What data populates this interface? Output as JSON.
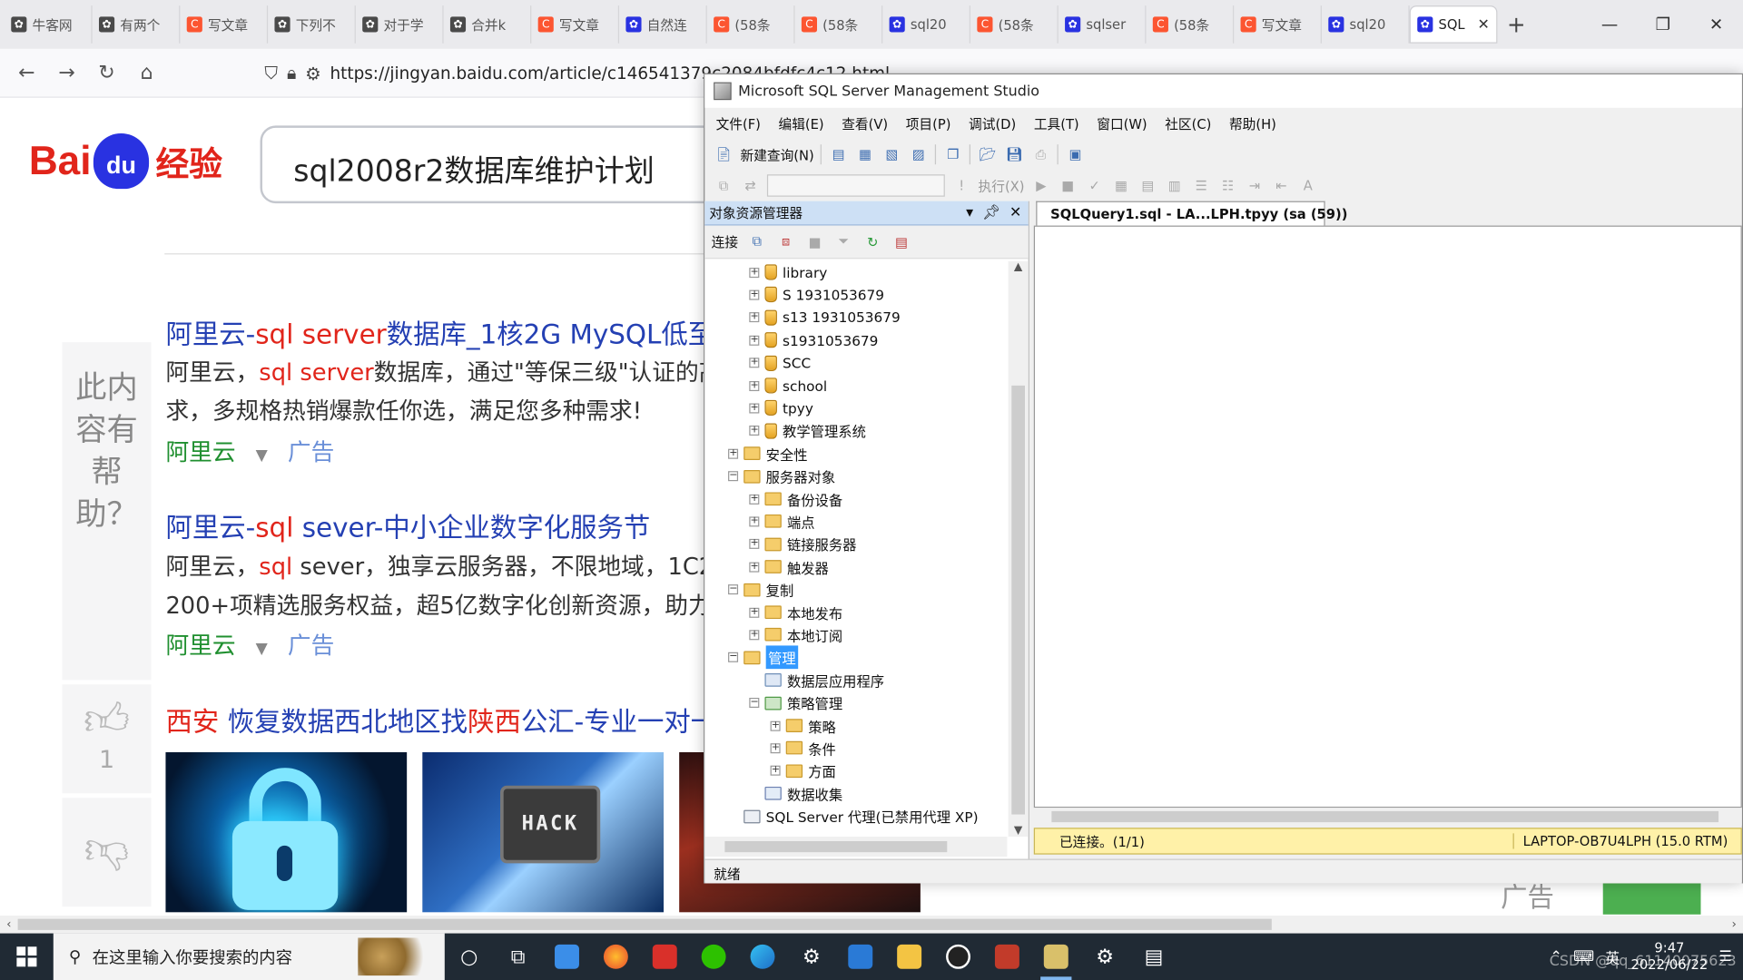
{
  "browser": {
    "tabs": [
      {
        "label": "牛客网",
        "icon": "paw-icon",
        "color": "#4a4a4a"
      },
      {
        "label": "有两个",
        "icon": "paw-icon",
        "color": "#4a4a4a"
      },
      {
        "label": "写文章",
        "icon": "csdn-c-icon",
        "color": "#fc5531"
      },
      {
        "label": "下列不",
        "icon": "paw-icon",
        "color": "#4a4a4a"
      },
      {
        "label": "对于学",
        "icon": "paw-icon",
        "color": "#4a4a4a"
      },
      {
        "label": "合并k",
        "icon": "paw-icon",
        "color": "#4a4a4a"
      },
      {
        "label": "写文章",
        "icon": "csdn-c-icon",
        "color": "#fc5531"
      },
      {
        "label": "自然连",
        "icon": "baidu-paw-icon",
        "color": "#2932e1"
      },
      {
        "label": "(58条",
        "icon": "csdn-c-icon",
        "color": "#fc5531"
      },
      {
        "label": "(58条",
        "icon": "csdn-c-icon",
        "color": "#fc5531"
      },
      {
        "label": "sql20",
        "icon": "baidu-paw-icon",
        "color": "#2932e1"
      },
      {
        "label": "(58条",
        "icon": "csdn-c-icon",
        "color": "#fc5531"
      },
      {
        "label": "sqlser",
        "icon": "baidu-paw-icon",
        "color": "#2932e1"
      },
      {
        "label": "(58条",
        "icon": "csdn-c-icon",
        "color": "#fc5531"
      },
      {
        "label": "写文章",
        "icon": "csdn-c-icon",
        "color": "#fc5531"
      },
      {
        "label": "sql20",
        "icon": "baidu-paw-icon",
        "color": "#2932e1"
      },
      {
        "label": "SQL",
        "icon": "baidu-paw-icon",
        "color": "#2932e1",
        "active": true
      }
    ],
    "new_tab": "+",
    "window_buttons": {
      "min": "—",
      "restore": "❐",
      "close": "✕"
    },
    "url": "https://jingyan.baidu.com/article/c146541379c2084bfdfc4c12.html"
  },
  "baidu": {
    "logo": {
      "bai": "Bai",
      "du": "du",
      "jingyan": "经验"
    },
    "search_value": "sql2008r2数据库维护计划",
    "helpful_prompt": "此内容有帮助？",
    "like_count": "1",
    "results": [
      {
        "title_pre": "阿里云-",
        "title_em": "sql server",
        "title_post": "数据库_1核2G MySQL低至",
        "desc1_pre": "阿里云，",
        "desc1_em": "sql server",
        "desc1_post": "数据库，通过\"等保三级\"认证的高",
        "desc2": "求，多规格热销爆款任你选，满足您多种需求!",
        "source": "阿里云",
        "ad": "广告"
      },
      {
        "title_pre": "阿里云-",
        "title_em": "sql",
        "title_post": " sever-中小企业数字化服务节",
        "desc1_pre": "阿里云，",
        "desc1_em": "sql",
        "desc1_post": " sever，独享云服务器，不限地域，1C2",
        "desc2": "200+项精选服务权益，超5亿数字化创新资源，助力",
        "source": "阿里云",
        "ad": "广告"
      }
    ],
    "result3": {
      "title_em1": "西安",
      "title_mid": " 恢复数据西北地区找",
      "title_em2": "陕西",
      "title_post": "公汇-专业一对一"
    },
    "image2_text": "HACK",
    "ghost_ad": "广告"
  },
  "ssms": {
    "title": "Microsoft SQL Server Management Studio",
    "menu": [
      "文件(F)",
      "编辑(E)",
      "查看(V)",
      "项目(P)",
      "调试(D)",
      "工具(T)",
      "窗口(W)",
      "社区(C)",
      "帮助(H)"
    ],
    "new_query": "新建查询(N)",
    "execute": "执行(X)",
    "object_explorer": {
      "title": "对象资源管理器",
      "connect": "连接",
      "tree": [
        {
          "label": "library",
          "level": 2,
          "type": "db",
          "toggle": "+"
        },
        {
          "label": "S 1931053679",
          "level": 2,
          "type": "db",
          "toggle": "+"
        },
        {
          "label": "s13 1931053679",
          "level": 2,
          "type": "db",
          "toggle": "+"
        },
        {
          "label": "s1931053679",
          "level": 2,
          "type": "db",
          "toggle": "+"
        },
        {
          "label": "SCC",
          "level": 2,
          "type": "db",
          "toggle": "+"
        },
        {
          "label": "school",
          "level": 2,
          "type": "db",
          "toggle": "+"
        },
        {
          "label": "tpyy",
          "level": 2,
          "type": "db",
          "toggle": "+"
        },
        {
          "label": "教学管理系统",
          "level": 2,
          "type": "db",
          "toggle": "+"
        },
        {
          "label": "安全性",
          "level": 1,
          "type": "folder",
          "toggle": "+"
        },
        {
          "label": "服务器对象",
          "level": 1,
          "type": "folder",
          "toggle": "−"
        },
        {
          "label": "备份设备",
          "level": 2,
          "type": "folder",
          "toggle": "+"
        },
        {
          "label": "端点",
          "level": 2,
          "type": "folder",
          "toggle": "+"
        },
        {
          "label": "链接服务器",
          "level": 2,
          "type": "folder",
          "toggle": "+"
        },
        {
          "label": "触发器",
          "level": 2,
          "type": "folder",
          "toggle": "+"
        },
        {
          "label": "复制",
          "level": 1,
          "type": "folder",
          "toggle": "−"
        },
        {
          "label": "本地发布",
          "level": 2,
          "type": "folder",
          "toggle": "+"
        },
        {
          "label": "本地订阅",
          "level": 2,
          "type": "folder",
          "toggle": "+"
        },
        {
          "label": "管理",
          "level": 1,
          "type": "folder",
          "toggle": "−",
          "selected": true
        },
        {
          "label": "数据层应用程序",
          "level": 2,
          "type": "app",
          "toggle": ""
        },
        {
          "label": "策略管理",
          "level": 2,
          "type": "policy",
          "toggle": "−"
        },
        {
          "label": "策略",
          "level": 3,
          "type": "folder",
          "toggle": "+"
        },
        {
          "label": "条件",
          "level": 3,
          "type": "folder",
          "toggle": "+"
        },
        {
          "label": "方面",
          "level": 3,
          "type": "folder",
          "toggle": "+"
        },
        {
          "label": "数据收集",
          "level": 2,
          "type": "collect",
          "toggle": ""
        },
        {
          "label": "SQL Server 代理(已禁用代理 XP)",
          "level": 1,
          "type": "agent",
          "toggle": ""
        }
      ]
    },
    "query_tab": "SQLQuery1.sql - LA...LPH.tpyy (sa (59))",
    "query_status": {
      "connected": "已连接。(1/1)",
      "server": "LAPTOP-OB7U4LPH (15.0 RTM)"
    },
    "status": "就绪"
  },
  "taskbar": {
    "search_placeholder": "在这里输入你要搜索的内容",
    "ime": "英",
    "time": "9:47",
    "date": "2022/06/22",
    "watermark": "CSDN @qq_61140075623"
  }
}
